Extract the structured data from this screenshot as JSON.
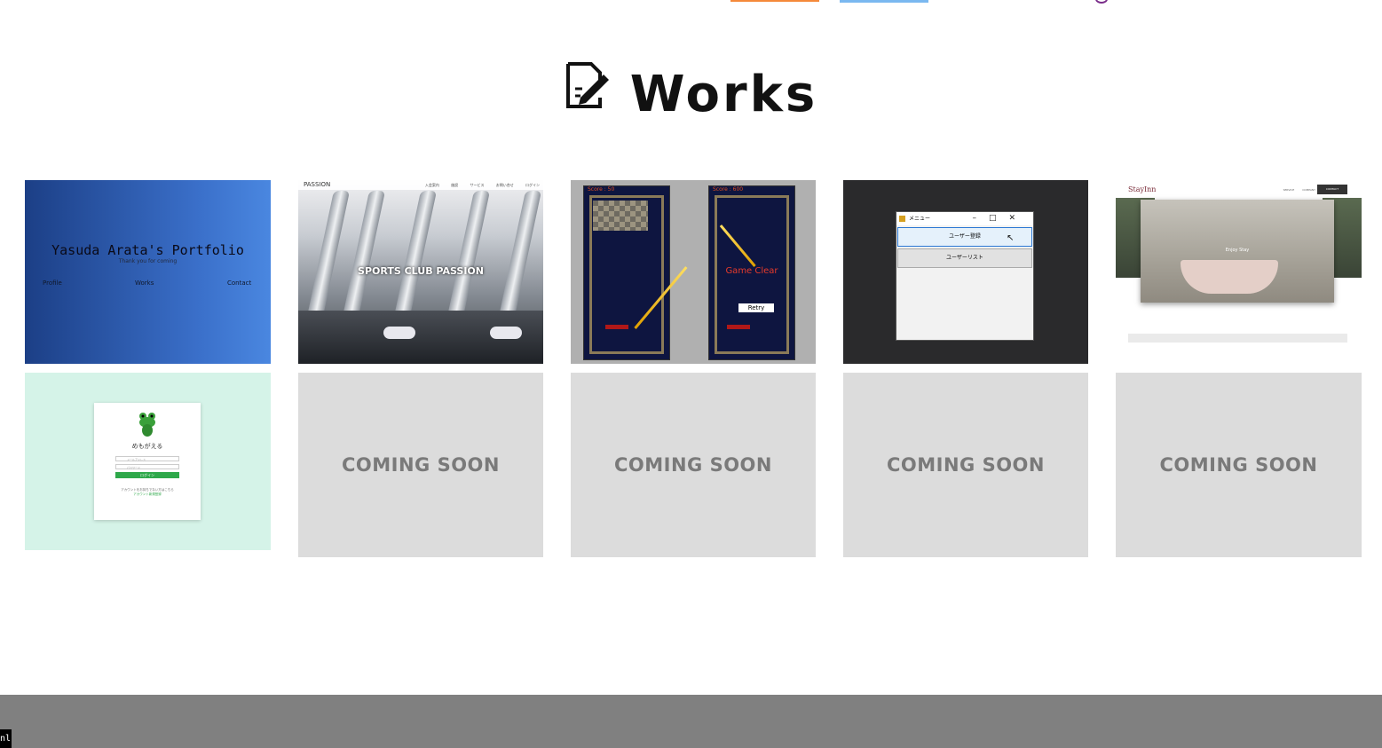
{
  "page_title": "Works",
  "top_accents": {
    "orange": "#f5893a",
    "blue": "#7ab8f0",
    "purple": "#7a2d8a"
  },
  "works": [
    {
      "name": "portfolio",
      "thumb_title": "Yasuda Arata's Portfolio",
      "thumb_subtitle": "Thank you for coming",
      "thumb_nav": [
        "Profile",
        "Works",
        "Contact"
      ]
    },
    {
      "name": "sports-club",
      "thumb_logo": "PASSION",
      "thumb_nav": "入会案内 施設 サービス お問い合せ ログイン",
      "thumb_banner": "SPORTS CLUB PASSION"
    },
    {
      "name": "block-game",
      "score_left": "Score : 50",
      "score_right": "Score : 600",
      "clear_text": "Game Clear",
      "retry_label": "Retry"
    },
    {
      "name": "windows-menu-app",
      "window_title": "メニュー",
      "button1": "ユーザー登録",
      "button2": "ユーザーリスト"
    },
    {
      "name": "stayinn",
      "logo": "StayInn",
      "nav": "SERVICE COMPANY",
      "contact": "CONTACT",
      "welcome": "Enjoy Stay"
    },
    {
      "name": "memogaeru",
      "app_name": "めもがえる",
      "email_placeholder": "メールアドレス",
      "password_placeholder": "パスワード",
      "login_label": "ログイン",
      "note_text": "アカウントをお持ちでない方はこちら",
      "note_link": "アカウント新規登録"
    }
  ],
  "coming_soon_label": "COMING SOON",
  "coming_soon_count": 4,
  "footer": {
    "color": "#808080"
  },
  "corner_tag": "nl"
}
